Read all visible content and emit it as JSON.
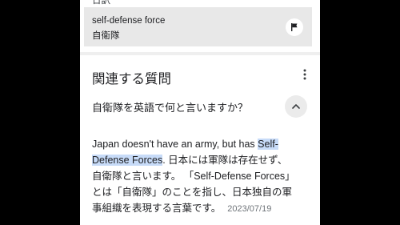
{
  "header_partial": "日訳",
  "translation": {
    "source_text": "self-defense force",
    "target_text": "自衛隊",
    "feedback_icon": "flag-icon"
  },
  "related_questions": {
    "title": "関連する質問",
    "menu_icon": "more-vert-icon",
    "question": "自衛隊を英語で何と言いますか？",
    "toggle_icon": "chevron-up-icon",
    "answer": {
      "line1": "Japan doesn't have an army, but has ",
      "line1_highlight": "Self-",
      "line2_highlight": "Defense Forces",
      "line2": ". 日本には軍隊は存在せず、",
      "line3": "自衛隊と言います。 「Self-Defense Forces」",
      "line4": "とは「自衛隊」のことを指し、日本独自の軍",
      "line5": "事組織を表現する言葉です。",
      "date": "2023/07/19"
    }
  },
  "colors": {
    "text": "#202124",
    "muted": "#70757a",
    "panel": "#e8e8e8",
    "highlight": "#c7dbf8"
  }
}
